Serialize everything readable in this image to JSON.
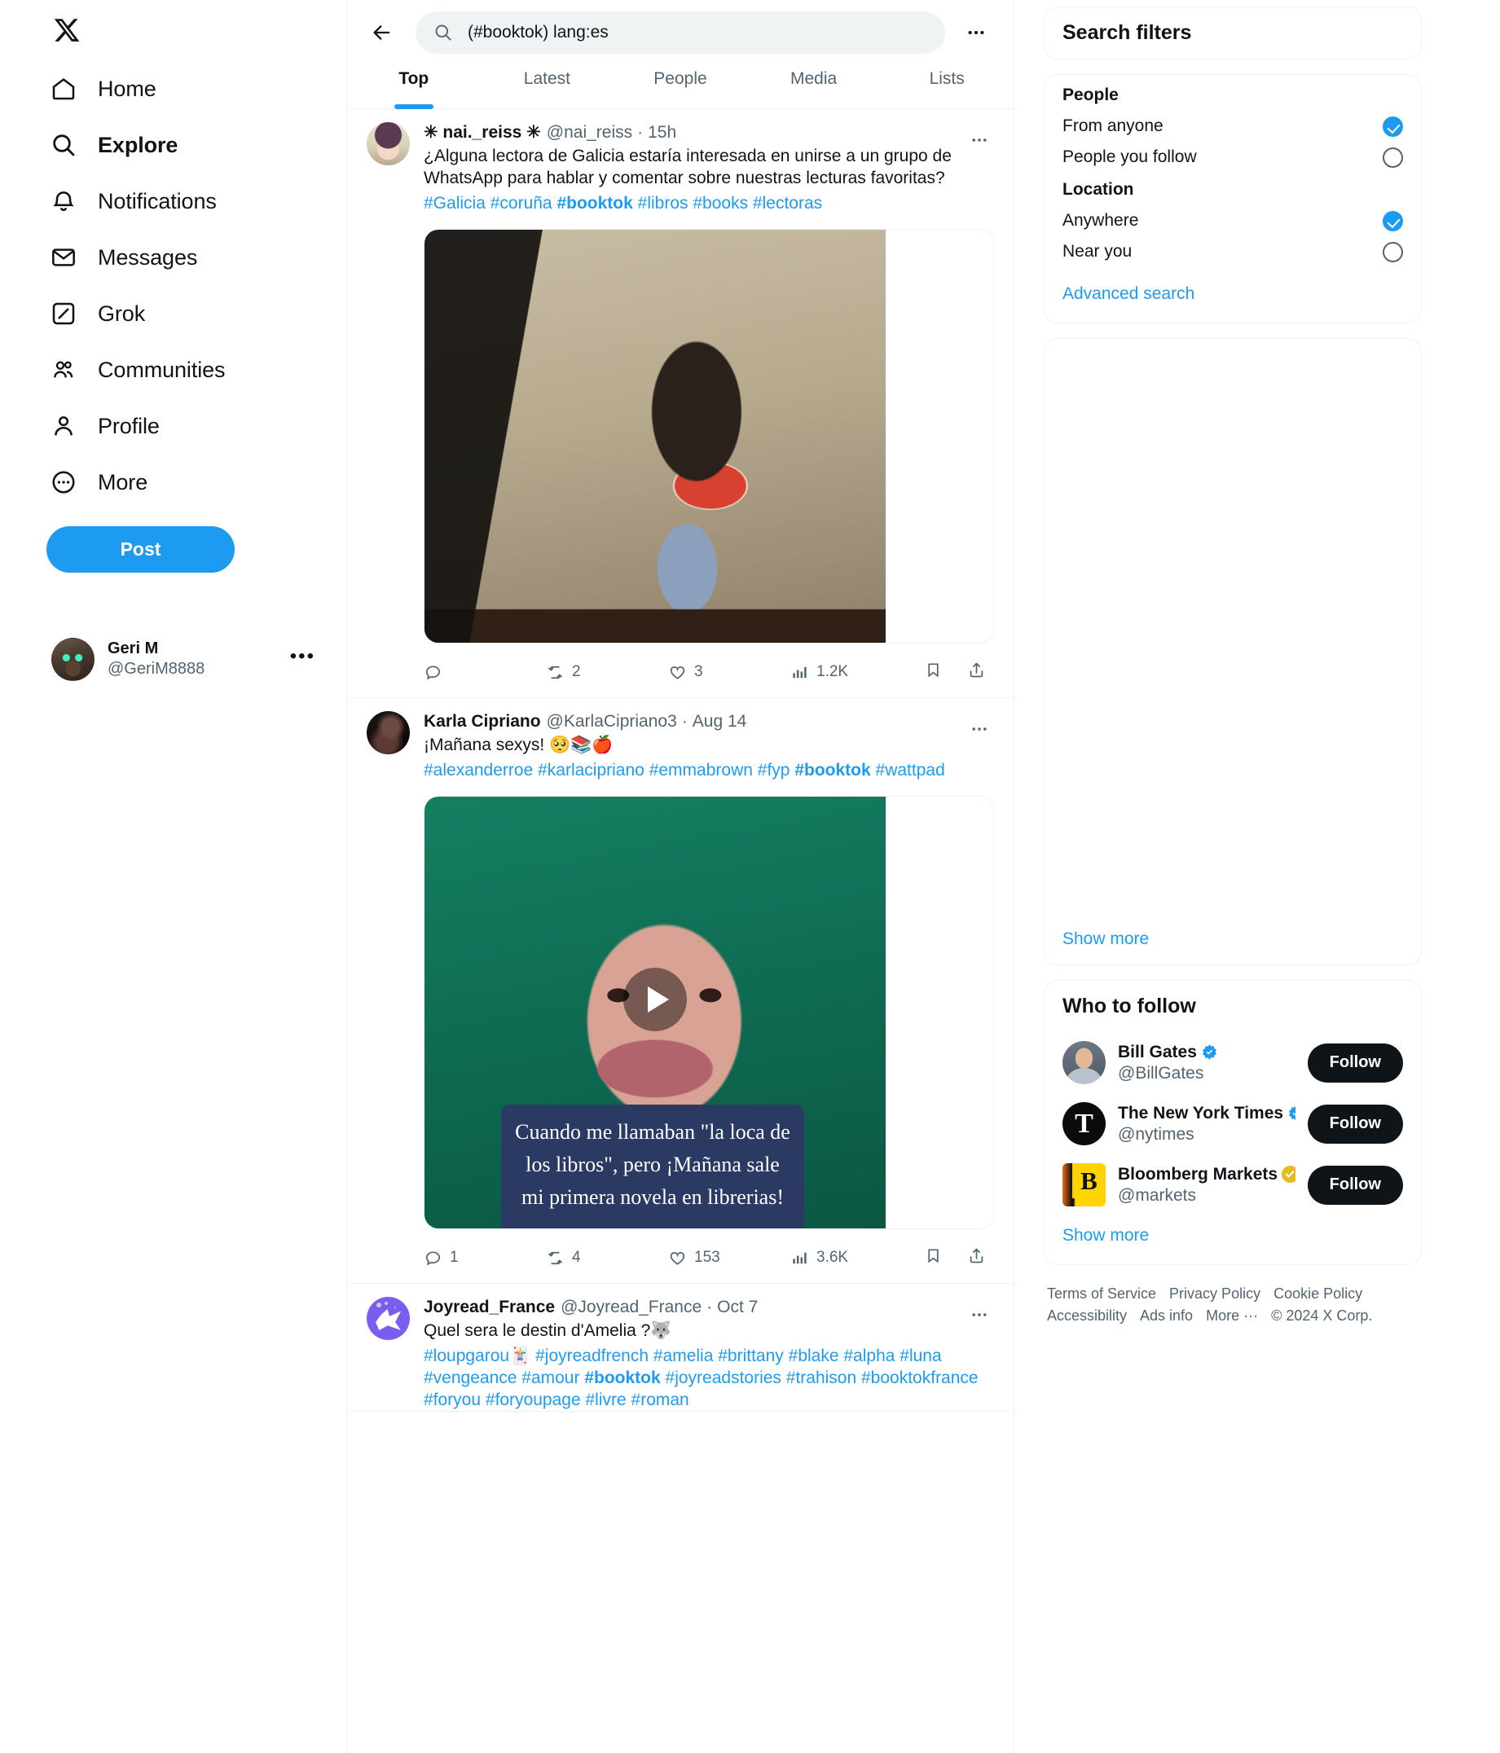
{
  "brand": {
    "logo": "x-logo",
    "accent": "#1d9bf0",
    "text_primary": "#0f1419",
    "text_muted": "#536471"
  },
  "sidebar": {
    "items": [
      {
        "label": "Home",
        "icon": "home-icon",
        "active": false
      },
      {
        "label": "Explore",
        "icon": "search-icon",
        "active": true
      },
      {
        "label": "Notifications",
        "icon": "bell-icon",
        "active": false
      },
      {
        "label": "Messages",
        "icon": "envelope-icon",
        "active": false
      },
      {
        "label": "Grok",
        "icon": "grok-icon",
        "active": false
      },
      {
        "label": "Communities",
        "icon": "communities-icon",
        "active": false
      },
      {
        "label": "Profile",
        "icon": "person-icon",
        "active": false
      },
      {
        "label": "More",
        "icon": "more-circle-icon",
        "active": false
      }
    ],
    "post_button": "Post",
    "account": {
      "name": "Geri M",
      "handle": "@GeriM8888",
      "menu": "•••",
      "avatar": "cat-avatar"
    }
  },
  "search": {
    "query": "(#booktok) lang:es",
    "placeholder": "Search",
    "back_icon": "back-arrow-icon",
    "search_icon": "search-icon",
    "overflow_icon": "more-horizontal-icon"
  },
  "tabs": [
    {
      "label": "Top",
      "active": true
    },
    {
      "label": "Latest",
      "active": false
    },
    {
      "label": "People",
      "active": false
    },
    {
      "label": "Media",
      "active": false
    },
    {
      "label": "Lists",
      "active": false
    }
  ],
  "tweets": [
    {
      "name": "✳ nai._reiss ✳",
      "handle": "@nai_reiss",
      "sep": "·",
      "time": "15h",
      "text": "¿Alguna lectora de Galicia estaría interesada en unirse a un grupo de WhatsApp para hablar y comentar sobre nuestras lecturas favoritas?",
      "hashtags": "#Galicia #coruña #booktok #libros #books #lectoras",
      "hashtags_bold": "#booktok",
      "media_type": "photo",
      "media_alt": "Woman sitting by a window drinking from a cup while reading a red book titled FUNNY YOU SHOULD ASH",
      "replies": "",
      "reposts": "2",
      "likes": "3",
      "views": "1.2K",
      "overflow": "•••"
    },
    {
      "name": "Karla Cipriano",
      "handle": "@KarlaCipriano3",
      "sep": "·",
      "time": "Aug 14",
      "text": "¡Mañana sexys! 🥺📚🍎",
      "hashtags": "#alexanderroe #karlacipriano #emmabrown #fyp #booktok #wattpad",
      "hashtags_bold": "#booktok",
      "media_type": "video",
      "media_alt": "Close-up video of a woman against a green background",
      "video_caption": "Cuando me llamaban \"la loca de los libros\", pero ¡Mañana sale mi primera novela en librerias!",
      "replies": "1",
      "reposts": "4",
      "likes": "153",
      "views": "3.6K",
      "overflow": "•••"
    },
    {
      "name": "Joyread_France",
      "handle": "@Joyread_France",
      "sep": "·",
      "time": "Oct 7",
      "text": "Quel sera le destin d'Amelia ?🐺",
      "hashtags": "#loupgarou🃏 #joyreadfrench #amelia #brittany #blake #alpha #luna #vengeance #amour #booktok #joyreadstories #trahison #booktokfrance #foryou #foryoupage #livre #roman",
      "hashtags_bold": "#booktok",
      "media_type": "none",
      "overflow": "•••"
    }
  ],
  "action_icons": {
    "reply": "reply-icon",
    "repost": "repost-icon",
    "like": "heart-icon",
    "views": "analytics-icon",
    "bookmark": "bookmark-icon",
    "share": "share-icon"
  },
  "right": {
    "search_filters": {
      "title": "Search filters",
      "groups": [
        {
          "label": "People",
          "options": [
            {
              "label": "From anyone",
              "selected": true
            },
            {
              "label": "People you follow",
              "selected": false
            }
          ]
        },
        {
          "label": "Location",
          "options": [
            {
              "label": "Anywhere",
              "selected": true
            },
            {
              "label": "Near you",
              "selected": false
            }
          ]
        }
      ],
      "advanced_search": "Advanced search"
    },
    "blank_panel": {
      "show_more": "Show more"
    },
    "who_to_follow": {
      "title": "Who to follow",
      "accounts": [
        {
          "name": "Bill Gates",
          "handle": "@BillGates",
          "verified": true,
          "gold": false,
          "affiliate": false,
          "follow": "Follow",
          "avatar": "bill-gates-avatar"
        },
        {
          "name": "The New York Times",
          "handle": "@nytimes",
          "verified": true,
          "gold": false,
          "affiliate": false,
          "follow": "Follow",
          "avatar": "nyt-avatar"
        },
        {
          "name": "Bloomberg Markets",
          "handle": "@markets",
          "verified": false,
          "gold": true,
          "affiliate": true,
          "affiliate_letter": "B",
          "follow": "Follow",
          "avatar": "bloomberg-avatar"
        }
      ],
      "show_more": "Show more"
    },
    "footer": {
      "links_row1": [
        "Terms of Service",
        "Privacy Policy",
        "Cookie Policy"
      ],
      "links_row2": [
        "Accessibility",
        "Ads info",
        "More ···"
      ],
      "copyright": "© 2024 X Corp."
    }
  }
}
